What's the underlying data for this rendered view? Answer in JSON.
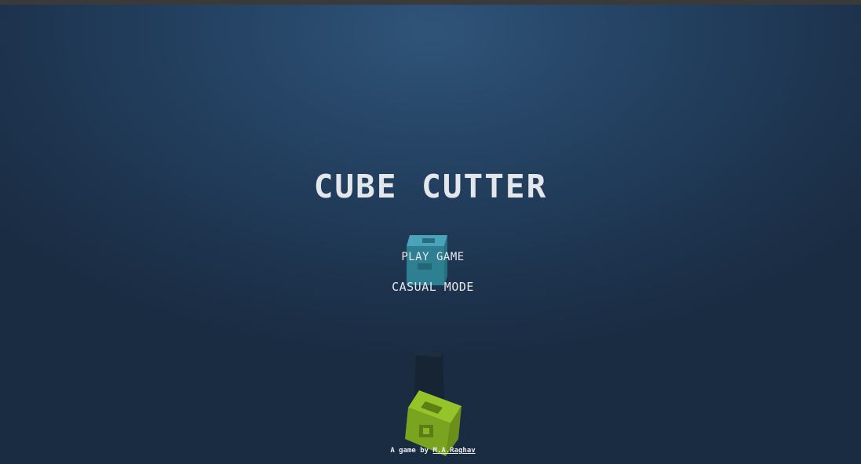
{
  "game": {
    "title": "CUBE CUTTER",
    "menu": {
      "play": "PLAY GAME",
      "casual": "CASUAL MODE"
    },
    "credit": {
      "prefix": "A game by ",
      "author": "M.A.Raghav"
    }
  },
  "colors": {
    "background_top": "#2f5478",
    "background_bottom": "#1a2c42",
    "menu_cube": "#3e93a8",
    "green_cube": "#8bb526",
    "text": "#e3e7ec"
  },
  "icons": {
    "menu_cube": "teal-cube-icon",
    "shadow_cube": "dark-cube-icon",
    "green_cube": "green-cube-icon"
  }
}
